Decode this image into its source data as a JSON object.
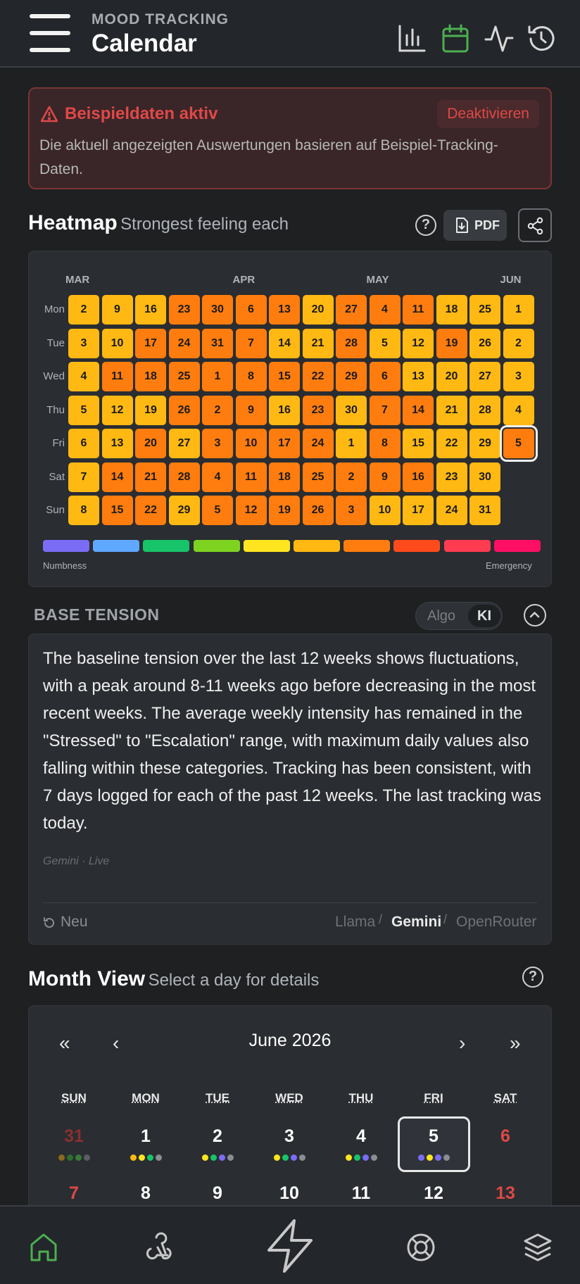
{
  "header": {
    "subtitle": "MOOD TRACKING",
    "title": "Calendar",
    "icons": [
      "bar-chart-icon",
      "calendar-icon",
      "activity-icon",
      "history-icon"
    ],
    "active_color": "#4caf50"
  },
  "banner": {
    "title": "Beispieldaten aktiv",
    "button": "Deaktivieren",
    "text": "Die aktuell angezeigten Auswertungen basieren auf Beispiel-Tracking-Daten."
  },
  "heatmap": {
    "title": "Heatmap",
    "subtitle": "Strongest feeling each",
    "pdf_label": "PDF",
    "months": [
      "MAR",
      "APR",
      "MAY",
      "JUN"
    ],
    "days": [
      "Mon",
      "Tue",
      "Wed",
      "Thu",
      "Fri",
      "Sat",
      "Sun"
    ],
    "legend_min": "Numbness",
    "legend_max": "Emergency",
    "legend_colors": [
      "#7b6cf6",
      "#5fa8ff",
      "#18c46a",
      "#7ed321",
      "#ffe51f",
      "#ffb912",
      "#ff7d0e",
      "#ff4a1c",
      "#ff3b52",
      "#ff0f64"
    ],
    "level_colors": {
      "y": "#ffb912",
      "o": "#ff7d0e"
    },
    "selected_day": "5",
    "columns": [
      {
        "days": [
          "2",
          "3",
          "4",
          "5",
          "6",
          "7",
          "8"
        ],
        "levels": [
          "y",
          "y",
          "y",
          "y",
          "y",
          "y",
          "y"
        ]
      },
      {
        "days": [
          "9",
          "10",
          "11",
          "12",
          "13",
          "14",
          "15"
        ],
        "levels": [
          "y",
          "y",
          "o",
          "y",
          "y",
          "o",
          "o"
        ]
      },
      {
        "days": [
          "16",
          "17",
          "18",
          "19",
          "20",
          "21",
          "22"
        ],
        "levels": [
          "y",
          "o",
          "o",
          "y",
          "o",
          "o",
          "o"
        ]
      },
      {
        "days": [
          "23",
          "24",
          "25",
          "26",
          "27",
          "28",
          "29"
        ],
        "levels": [
          "o",
          "o",
          "o",
          "o",
          "y",
          "o",
          "y"
        ]
      },
      {
        "days": [
          "30",
          "31",
          "1",
          "2",
          "3",
          "4",
          "5"
        ],
        "levels": [
          "o",
          "o",
          "o",
          "o",
          "o",
          "o",
          "o"
        ]
      },
      {
        "days": [
          "6",
          "7",
          "8",
          "9",
          "10",
          "11",
          "12"
        ],
        "levels": [
          "o",
          "o",
          "o",
          "o",
          "o",
          "o",
          "o"
        ]
      },
      {
        "days": [
          "13",
          "14",
          "15",
          "16",
          "17",
          "18",
          "19"
        ],
        "levels": [
          "o",
          "y",
          "o",
          "y",
          "o",
          "o",
          "o"
        ]
      },
      {
        "days": [
          "20",
          "21",
          "22",
          "23",
          "24",
          "25",
          "26"
        ],
        "levels": [
          "y",
          "y",
          "o",
          "o",
          "o",
          "o",
          "o"
        ]
      },
      {
        "days": [
          "27",
          "28",
          "29",
          "30",
          "1",
          "2",
          "3"
        ],
        "levels": [
          "o",
          "o",
          "o",
          "y",
          "y",
          "o",
          "o"
        ]
      },
      {
        "days": [
          "4",
          "5",
          "6",
          "7",
          "8",
          "9",
          "10"
        ],
        "levels": [
          "o",
          "y",
          "o",
          "o",
          "o",
          "o",
          "y"
        ]
      },
      {
        "days": [
          "11",
          "12",
          "13",
          "14",
          "15",
          "16",
          "17"
        ],
        "levels": [
          "o",
          "y",
          "y",
          "o",
          "y",
          "o",
          "y"
        ]
      },
      {
        "days": [
          "18",
          "19",
          "20",
          "21",
          "22",
          "23",
          "24"
        ],
        "levels": [
          "y",
          "o",
          "y",
          "y",
          "y",
          "y",
          "y"
        ]
      },
      {
        "days": [
          "25",
          "26",
          "27",
          "28",
          "29",
          "30",
          "31"
        ],
        "levels": [
          "y",
          "y",
          "y",
          "y",
          "y",
          "y",
          "y"
        ]
      },
      {
        "days": [
          "1",
          "2",
          "3",
          "4",
          "5"
        ],
        "levels": [
          "y",
          "y",
          "y",
          "y",
          "o"
        ]
      }
    ]
  },
  "base_tension": {
    "title": "BASE TENSION",
    "toggle_a": "Algo",
    "toggle_b": "KI",
    "text": "The baseline tension over the last 12 weeks shows fluctuations, with a peak around 8-11 weeks ago before decreasing in the most recent weeks. The average weekly intensity has remained in the \"Stressed\" to \"Escalation\" range, with maximum daily values also falling within these categories. Tracking has been consistent, with 7 days logged for each of the past 12 weeks. The last tracking was today.",
    "meta": "Gemini · Live",
    "new_label": "Neu",
    "providers": [
      "Llama",
      "Gemini",
      "OpenRouter"
    ],
    "active_provider": "Gemini"
  },
  "month_view": {
    "title": "Month View",
    "subtitle": "Select a day for details",
    "nav": {
      "first": "«",
      "prev": "‹",
      "next": "›",
      "last": "»"
    },
    "month_label": "June 2026",
    "weekdays": [
      "SUN",
      "MON",
      "TUE",
      "WED",
      "THU",
      "FRI",
      "SAT"
    ],
    "row1": [
      {
        "d": "31",
        "state": "out",
        "dots": [
          "#8a6a1a",
          "#2e6e2e",
          "#3a7a3a",
          "#5a5e64"
        ]
      },
      {
        "d": "1",
        "state": "",
        "dots": [
          "#ffb912",
          "#ffe51f",
          "#18c46a",
          "#8a8e94"
        ]
      },
      {
        "d": "2",
        "state": "",
        "dots": [
          "#ffe51f",
          "#18c46a",
          "#7b6cf6",
          "#8a8e94"
        ]
      },
      {
        "d": "3",
        "state": "",
        "dots": [
          "#ffe51f",
          "#18c46a",
          "#7b6cf6",
          "#8a8e94"
        ]
      },
      {
        "d": "4",
        "state": "",
        "dots": [
          "#ffe51f",
          "#18c46a",
          "#7b6cf6",
          "#8a8e94"
        ]
      },
      {
        "d": "5",
        "state": "selected",
        "dots": [
          "#7b6cf6",
          "#ffe51f",
          "#7b6cf6",
          "#8a8e94"
        ]
      },
      {
        "d": "6",
        "state": "red",
        "dots": []
      }
    ],
    "row2": [
      "7",
      "8",
      "9",
      "10",
      "11",
      "12",
      "13"
    ]
  },
  "bottom_nav": [
    "home-icon",
    "webhook-icon",
    "bolt-icon",
    "lifebuoy-icon",
    "layers-icon"
  ]
}
